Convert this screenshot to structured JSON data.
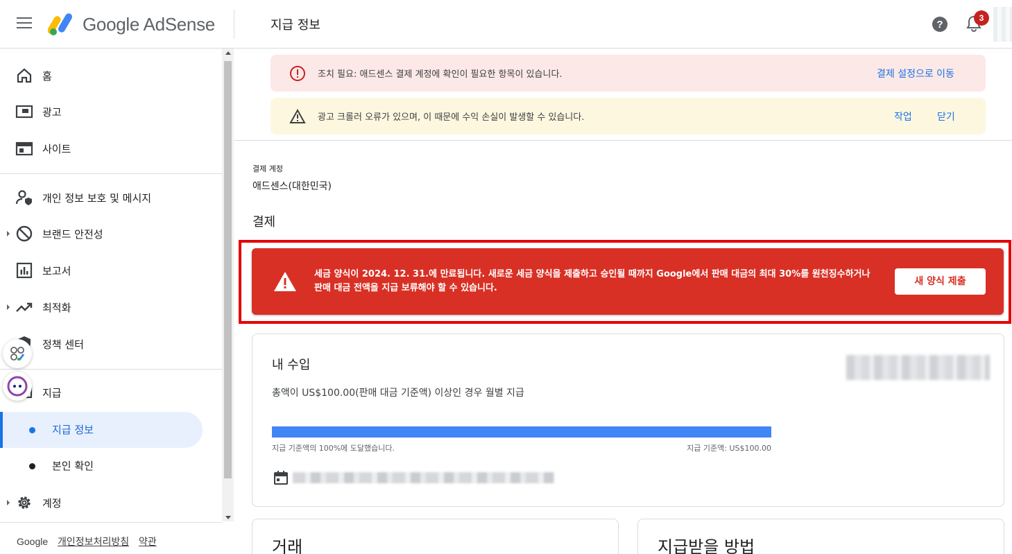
{
  "header": {
    "brand": "Google AdSense",
    "page_title": "지급 정보",
    "notification_count": "3"
  },
  "sidebar": {
    "items": [
      {
        "label": "홈",
        "icon": "home-icon"
      },
      {
        "label": "광고",
        "icon": "ads-icon"
      },
      {
        "label": "사이트",
        "icon": "sites-icon"
      },
      {
        "label": "개인 정보 보호 및 메시지",
        "icon": "privacy-icon"
      },
      {
        "label": "브랜드 안전성",
        "icon": "block-icon"
      },
      {
        "label": "보고서",
        "icon": "reports-icon"
      },
      {
        "label": "최적화",
        "icon": "trending-icon"
      },
      {
        "label": "정책 센터",
        "icon": "policy-icon"
      },
      {
        "label": "지급",
        "icon": "payments-icon"
      },
      {
        "label": "계정",
        "icon": "gear-icon"
      }
    ],
    "sub_items": [
      {
        "label": "지급 정보",
        "active": true
      },
      {
        "label": "본인 확인",
        "active": false
      }
    ],
    "footer": {
      "google": "Google",
      "privacy": "개인정보처리방침",
      "terms": "약관"
    }
  },
  "alerts": {
    "error": {
      "text": "조치 필요: 애드센스 결제 계정에 확인이 필요한 항목이 있습니다.",
      "action": "결제 설정으로 이동"
    },
    "warning": {
      "text": "광고 크롤러 오류가 있으며, 이 때문에 수익 손실이 발생할 수 있습니다.",
      "action1": "작업",
      "action2": "닫기"
    }
  },
  "account": {
    "label": "결제 계정",
    "value": "애드센스(대한민국)"
  },
  "payment_section": {
    "title": "결제"
  },
  "tax_banner": {
    "line1": "세금 양식이 2024. 12. 31.에 만료됩니다. 새로운 세금 양식을 제출하고 승인될 때까지 Google에서 판매 대금의 최대 30%를 원천징수하거나",
    "line2": "판매 대금 전액을 지급 보류해야 할 수 있습니다.",
    "button": "새 양식 제출",
    "color": "#d93025"
  },
  "earnings": {
    "title": "내 수입",
    "description": "총액이 US$100.00(판매 대금 기준액) 이상인 경우 월별 지급",
    "progress_percent": 100,
    "progress_left": "지급 기준액의 100%에 도달했습니다.",
    "progress_right": "지급 기준액: US$100.00",
    "progress_color": "#4285f4"
  },
  "cards": {
    "transactions": "거래",
    "payment_method": "지급받을 방법"
  }
}
